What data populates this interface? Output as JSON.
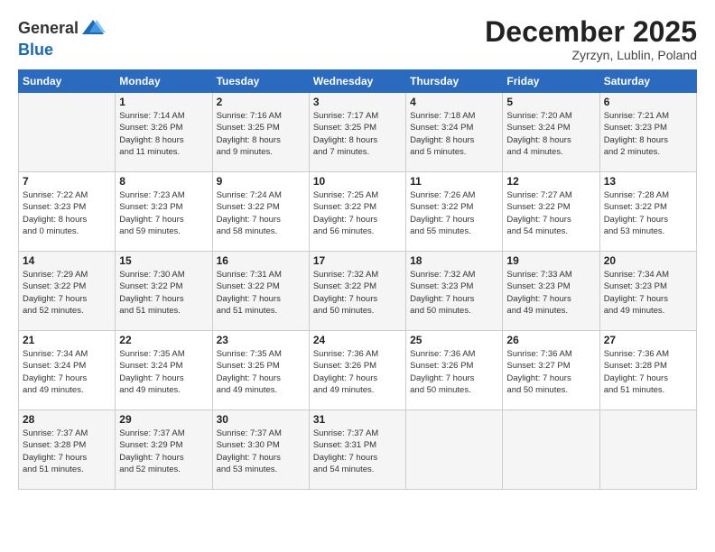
{
  "header": {
    "logo_line1": "General",
    "logo_line2": "Blue",
    "month": "December 2025",
    "location": "Zyrzyn, Lublin, Poland"
  },
  "weekdays": [
    "Sunday",
    "Monday",
    "Tuesday",
    "Wednesday",
    "Thursday",
    "Friday",
    "Saturday"
  ],
  "weeks": [
    [
      {
        "day": "",
        "info": ""
      },
      {
        "day": "1",
        "info": "Sunrise: 7:14 AM\nSunset: 3:26 PM\nDaylight: 8 hours\nand 11 minutes."
      },
      {
        "day": "2",
        "info": "Sunrise: 7:16 AM\nSunset: 3:25 PM\nDaylight: 8 hours\nand 9 minutes."
      },
      {
        "day": "3",
        "info": "Sunrise: 7:17 AM\nSunset: 3:25 PM\nDaylight: 8 hours\nand 7 minutes."
      },
      {
        "day": "4",
        "info": "Sunrise: 7:18 AM\nSunset: 3:24 PM\nDaylight: 8 hours\nand 5 minutes."
      },
      {
        "day": "5",
        "info": "Sunrise: 7:20 AM\nSunset: 3:24 PM\nDaylight: 8 hours\nand 4 minutes."
      },
      {
        "day": "6",
        "info": "Sunrise: 7:21 AM\nSunset: 3:23 PM\nDaylight: 8 hours\nand 2 minutes."
      }
    ],
    [
      {
        "day": "7",
        "info": "Sunrise: 7:22 AM\nSunset: 3:23 PM\nDaylight: 8 hours\nand 0 minutes."
      },
      {
        "day": "8",
        "info": "Sunrise: 7:23 AM\nSunset: 3:23 PM\nDaylight: 7 hours\nand 59 minutes."
      },
      {
        "day": "9",
        "info": "Sunrise: 7:24 AM\nSunset: 3:22 PM\nDaylight: 7 hours\nand 58 minutes."
      },
      {
        "day": "10",
        "info": "Sunrise: 7:25 AM\nSunset: 3:22 PM\nDaylight: 7 hours\nand 56 minutes."
      },
      {
        "day": "11",
        "info": "Sunrise: 7:26 AM\nSunset: 3:22 PM\nDaylight: 7 hours\nand 55 minutes."
      },
      {
        "day": "12",
        "info": "Sunrise: 7:27 AM\nSunset: 3:22 PM\nDaylight: 7 hours\nand 54 minutes."
      },
      {
        "day": "13",
        "info": "Sunrise: 7:28 AM\nSunset: 3:22 PM\nDaylight: 7 hours\nand 53 minutes."
      }
    ],
    [
      {
        "day": "14",
        "info": "Sunrise: 7:29 AM\nSunset: 3:22 PM\nDaylight: 7 hours\nand 52 minutes."
      },
      {
        "day": "15",
        "info": "Sunrise: 7:30 AM\nSunset: 3:22 PM\nDaylight: 7 hours\nand 51 minutes."
      },
      {
        "day": "16",
        "info": "Sunrise: 7:31 AM\nSunset: 3:22 PM\nDaylight: 7 hours\nand 51 minutes."
      },
      {
        "day": "17",
        "info": "Sunrise: 7:32 AM\nSunset: 3:22 PM\nDaylight: 7 hours\nand 50 minutes."
      },
      {
        "day": "18",
        "info": "Sunrise: 7:32 AM\nSunset: 3:23 PM\nDaylight: 7 hours\nand 50 minutes."
      },
      {
        "day": "19",
        "info": "Sunrise: 7:33 AM\nSunset: 3:23 PM\nDaylight: 7 hours\nand 49 minutes."
      },
      {
        "day": "20",
        "info": "Sunrise: 7:34 AM\nSunset: 3:23 PM\nDaylight: 7 hours\nand 49 minutes."
      }
    ],
    [
      {
        "day": "21",
        "info": "Sunrise: 7:34 AM\nSunset: 3:24 PM\nDaylight: 7 hours\nand 49 minutes."
      },
      {
        "day": "22",
        "info": "Sunrise: 7:35 AM\nSunset: 3:24 PM\nDaylight: 7 hours\nand 49 minutes."
      },
      {
        "day": "23",
        "info": "Sunrise: 7:35 AM\nSunset: 3:25 PM\nDaylight: 7 hours\nand 49 minutes."
      },
      {
        "day": "24",
        "info": "Sunrise: 7:36 AM\nSunset: 3:26 PM\nDaylight: 7 hours\nand 49 minutes."
      },
      {
        "day": "25",
        "info": "Sunrise: 7:36 AM\nSunset: 3:26 PM\nDaylight: 7 hours\nand 50 minutes."
      },
      {
        "day": "26",
        "info": "Sunrise: 7:36 AM\nSunset: 3:27 PM\nDaylight: 7 hours\nand 50 minutes."
      },
      {
        "day": "27",
        "info": "Sunrise: 7:36 AM\nSunset: 3:28 PM\nDaylight: 7 hours\nand 51 minutes."
      }
    ],
    [
      {
        "day": "28",
        "info": "Sunrise: 7:37 AM\nSunset: 3:28 PM\nDaylight: 7 hours\nand 51 minutes."
      },
      {
        "day": "29",
        "info": "Sunrise: 7:37 AM\nSunset: 3:29 PM\nDaylight: 7 hours\nand 52 minutes."
      },
      {
        "day": "30",
        "info": "Sunrise: 7:37 AM\nSunset: 3:30 PM\nDaylight: 7 hours\nand 53 minutes."
      },
      {
        "day": "31",
        "info": "Sunrise: 7:37 AM\nSunset: 3:31 PM\nDaylight: 7 hours\nand 54 minutes."
      },
      {
        "day": "",
        "info": ""
      },
      {
        "day": "",
        "info": ""
      },
      {
        "day": "",
        "info": ""
      }
    ]
  ]
}
